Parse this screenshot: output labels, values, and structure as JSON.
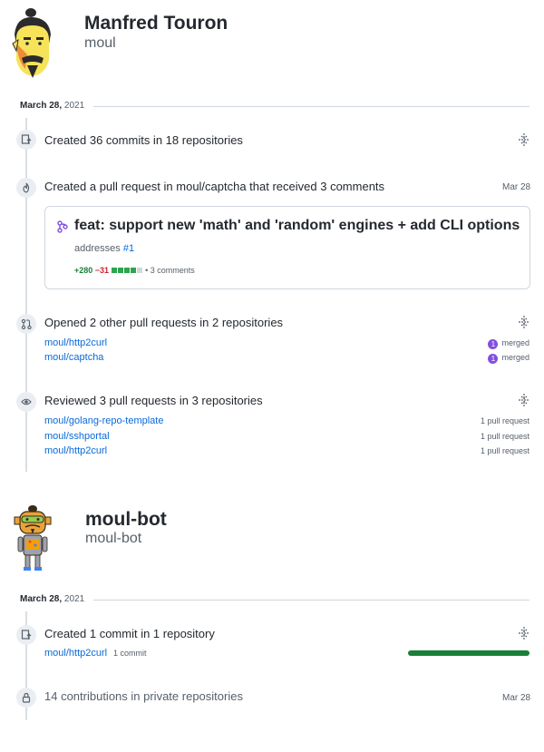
{
  "profiles": [
    {
      "name": "Manfred Touron",
      "login": "moul",
      "date": {
        "month_day": "March 28,",
        "year": "2021"
      },
      "events": {
        "commits": {
          "title": "Created 36 commits in 18 repositories",
          "icon": "repo-push-icon"
        },
        "pull_request": {
          "title": "Created a pull request in moul/captcha that received 3 comments",
          "date": "Mar 28",
          "icon": "git-pull-request-icon",
          "card": {
            "title": "feat: support new 'math' and 'random' engines + add CLI options",
            "body_prefix": "addresses",
            "body_link": "#1",
            "additions": "+280",
            "deletions": "−31",
            "comments": "• 3 comments"
          }
        },
        "opened": {
          "title": "Opened 2 other pull requests in 2 repositories",
          "icon": "git-compare-icon",
          "items": [
            {
              "repo": "moul/http2curl",
              "count": "1",
              "status": "merged"
            },
            {
              "repo": "moul/captcha",
              "count": "1",
              "status": "merged"
            }
          ]
        },
        "reviewed": {
          "title": "Reviewed 3 pull requests in 3 repositories",
          "icon": "eye-icon",
          "items": [
            {
              "repo": "moul/golang-repo-template",
              "meta": "1 pull request"
            },
            {
              "repo": "moul/sshportal",
              "meta": "1 pull request"
            },
            {
              "repo": "moul/http2curl",
              "meta": "1 pull request"
            }
          ]
        }
      }
    },
    {
      "name": "moul-bot",
      "login": "moul-bot",
      "date": {
        "month_day": "March 28,",
        "year": "2021"
      },
      "events": {
        "commits": {
          "title": "Created 1 commit in 1 repository",
          "icon": "repo-push-icon",
          "items": [
            {
              "repo": "moul/http2curl",
              "meta": "1 commit",
              "share": 1.0
            }
          ]
        },
        "private": {
          "title": "14 contributions in private repositories",
          "date": "Mar 28",
          "icon": "lock-icon"
        }
      }
    }
  ],
  "colors": {
    "link": "#0969da",
    "merged": "#8250df",
    "additions": "#1a7f37",
    "deletions": "#cf222e"
  }
}
